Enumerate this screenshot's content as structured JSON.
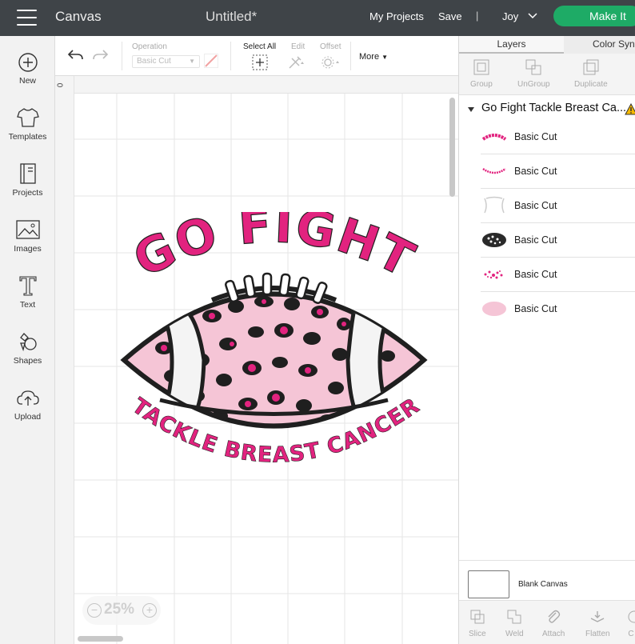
{
  "topbar": {
    "app_title": "Canvas",
    "doc_title": "Untitled*",
    "my_projects": "My Projects",
    "save": "Save",
    "separator": "|",
    "user": "Joy",
    "make_it": "Make It"
  },
  "sidebar": {
    "items": [
      {
        "label": "New",
        "icon": "plus-circle-icon"
      },
      {
        "label": "Templates",
        "icon": "shirt-icon"
      },
      {
        "label": "Projects",
        "icon": "notebook-icon"
      },
      {
        "label": "Images",
        "icon": "image-icon"
      },
      {
        "label": "Text",
        "icon": "text-t-icon"
      },
      {
        "label": "Shapes",
        "icon": "shapes-icon"
      },
      {
        "label": "Upload",
        "icon": "cloud-upload-icon"
      }
    ]
  },
  "toolbar": {
    "operation_label": "Operation",
    "operation_value": "Basic Cut",
    "select_all": "Select All",
    "edit": "Edit",
    "offset": "Offset",
    "more": "More"
  },
  "ruler": {
    "origin": "0"
  },
  "zoom": {
    "value": "25%",
    "minus": "−",
    "plus": "+"
  },
  "design": {
    "top_text": "GO FIGHT",
    "bottom_text": "TACKLE BREAST CANCER",
    "colors": {
      "pink": "#e2237f",
      "light_pink": "#f5c5d6",
      "black": "#1f1f1f",
      "white": "#ffffff"
    }
  },
  "panel": {
    "tabs": [
      "Layers",
      "Color Sync"
    ],
    "tools": [
      "Group",
      "UnGroup",
      "Duplicate"
    ],
    "group_name": "Go Fight Tackle Breast Ca...",
    "layers": [
      {
        "name": "Basic Cut",
        "thumb": "go-fight-text"
      },
      {
        "name": "Basic Cut",
        "thumb": "tackle-text"
      },
      {
        "name": "Basic Cut",
        "thumb": "white-stripes"
      },
      {
        "name": "Basic Cut",
        "thumb": "black-leopard"
      },
      {
        "name": "Basic Cut",
        "thumb": "pink-spots"
      },
      {
        "name": "Basic Cut",
        "thumb": "pink-oval"
      }
    ],
    "blank_canvas": "Blank Canvas",
    "bottom_tools": [
      "Slice",
      "Weld",
      "Attach",
      "Flatten",
      "C"
    ]
  }
}
